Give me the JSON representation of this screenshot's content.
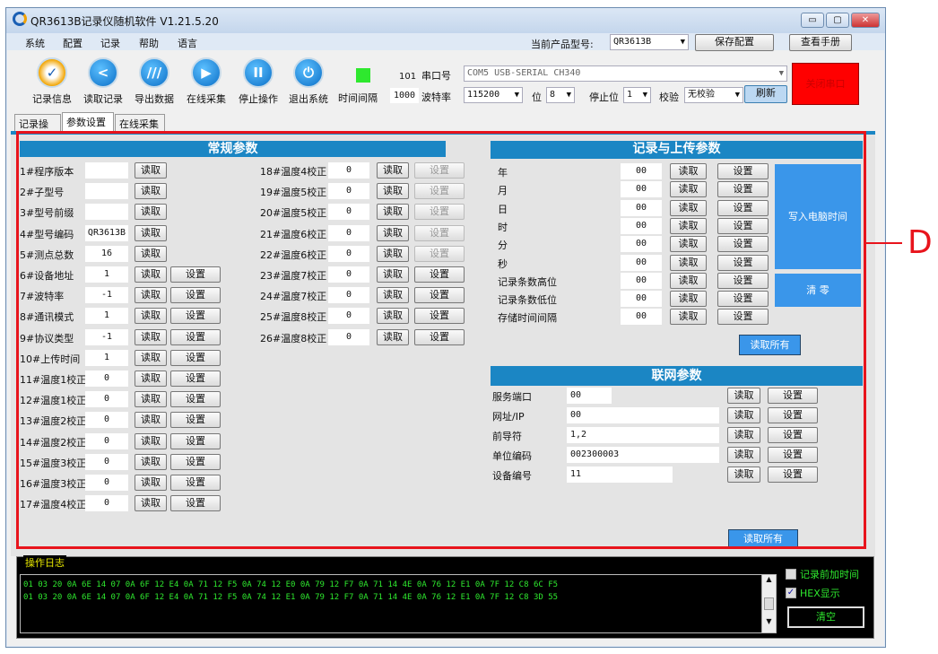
{
  "window": {
    "title": "QR3613B记录仪随机软件   V1.21.5.20"
  },
  "menu": [
    "系统",
    "配置",
    "记录",
    "帮助",
    "语言"
  ],
  "header": {
    "product_label": "当前产品型号:",
    "product_value": "QR3613B",
    "save_config": "保存配置",
    "view_manual": "查看手册"
  },
  "toolbar": {
    "buttons": [
      {
        "label": "记录信息",
        "icon": "record-info-icon",
        "glyph": "✓"
      },
      {
        "label": "读取记录",
        "icon": "share-icon",
        "glyph": "<"
      },
      {
        "label": "导出数据",
        "icon": "export-icon",
        "glyph": "///"
      },
      {
        "label": "在线采集",
        "icon": "play-icon",
        "glyph": "▶"
      },
      {
        "label": "停止操作",
        "icon": "pause-icon",
        "glyph": "II"
      },
      {
        "label": "退出系统",
        "icon": "power-icon",
        "glyph": "⏻"
      }
    ],
    "interval_label": "时间间隔",
    "interval_count": "101",
    "interval_value": "1000"
  },
  "serial": {
    "port_label": "串口号",
    "port_value": "COM5 USB-SERIAL CH340",
    "baud_label": "波特率",
    "baud_value": "115200",
    "bits_label": "位",
    "bits_value": "8",
    "stop_label": "停止位",
    "stop_value": "1",
    "parity_label": "校验",
    "parity_value": "无校验",
    "refresh": "刷新",
    "close_port": "关闭串口"
  },
  "tabs": [
    "记录操作",
    "参数设置",
    "在线采集"
  ],
  "read": "读取",
  "set": "设置",
  "general": {
    "title": "常规参数",
    "rows": [
      {
        "label": "1#程序版本",
        "value": "",
        "set": false
      },
      {
        "label": "2#子型号",
        "value": "",
        "set": false
      },
      {
        "label": "3#型号前缀",
        "value": "",
        "set": false
      },
      {
        "label": "4#型号编码",
        "value": "QR3613B",
        "set": false
      },
      {
        "label": "5#测点总数",
        "value": "16",
        "set": false
      },
      {
        "label": "6#设备地址",
        "value": "1",
        "set": true
      },
      {
        "label": "7#波特率",
        "value": "-1",
        "set": true
      },
      {
        "label": "8#通讯模式",
        "value": "1",
        "set": true
      },
      {
        "label": "9#协议类型",
        "value": "-1",
        "set": true
      },
      {
        "label": "10#上传时间",
        "value": "1",
        "set": true
      },
      {
        "label": "11#温度1校正",
        "value": "0",
        "set": true
      },
      {
        "label": "12#温度1校正",
        "value": "0",
        "set": true
      },
      {
        "label": "13#温度2校正",
        "value": "0",
        "set": true
      },
      {
        "label": "14#温度2校正",
        "value": "0",
        "set": true
      },
      {
        "label": "15#温度3校正",
        "value": "0",
        "set": true
      },
      {
        "label": "16#温度3校正",
        "value": "0",
        "set": true
      },
      {
        "label": "17#温度4校正",
        "value": "0",
        "set": true
      }
    ],
    "rows2": [
      {
        "label": "18#温度4校正",
        "value": "0",
        "set_enabled": false
      },
      {
        "label": "19#温度5校正",
        "value": "0",
        "set_enabled": false
      },
      {
        "label": "20#温度5校正",
        "value": "0",
        "set_enabled": false
      },
      {
        "label": "21#温度6校正",
        "value": "0",
        "set_enabled": false
      },
      {
        "label": "22#温度6校正",
        "value": "0",
        "set_enabled": false
      },
      {
        "label": "23#温度7校正",
        "value": "0",
        "set_enabled": true
      },
      {
        "label": "24#温度7校正",
        "value": "0",
        "set_enabled": true
      },
      {
        "label": "25#温度8校正",
        "value": "0",
        "set_enabled": true
      },
      {
        "label": "26#温度8校正",
        "value": "0",
        "set_enabled": true
      }
    ]
  },
  "record": {
    "title": "记录与上传参数",
    "rows": [
      {
        "label": "年",
        "value": "00"
      },
      {
        "label": "月",
        "value": "00"
      },
      {
        "label": "日",
        "value": "00"
      },
      {
        "label": "时",
        "value": "00"
      },
      {
        "label": "分",
        "value": "00"
      },
      {
        "label": "秒",
        "value": "00"
      },
      {
        "label": "记录条数高位",
        "value": "00"
      },
      {
        "label": "记录条数低位",
        "value": "00"
      },
      {
        "label": "存储时间间隔",
        "value": "00"
      }
    ],
    "write_pc_time": "写入电脑时间",
    "clear": "清 零",
    "read_all": "读取所有"
  },
  "network": {
    "title": "联网参数",
    "rows": [
      {
        "label": "服务端口",
        "value": "00"
      },
      {
        "label": "网址/IP",
        "value": "00"
      },
      {
        "label": "前导符",
        "value": "1,2"
      },
      {
        "label": "单位编码",
        "value": "002300003"
      },
      {
        "label": "设备编号",
        "value": "11"
      }
    ],
    "read_all": "读取所有"
  },
  "log": {
    "title": "操作日志",
    "lines": [
      "01 03 20 0A 6E 14 07 0A 6F 12 E4 0A 71 12 F5 0A 74 12 E0 0A 79 12 F7 0A 71 14 4E 0A 76 12 E1 0A 7F 12 C8 6C F5",
      "01 03 20 0A 6E 14 07 0A 6F 12 E4 0A 71 12 F5 0A 74 12 E1 0A 79 12 F7 0A 71 14 4E 0A 76 12 E1 0A 7F 12 C8 3D 55"
    ],
    "add_time_label": "记录前加时间",
    "add_time_checked": false,
    "hex_label": "HEX显示",
    "hex_checked": true,
    "clear": "清空"
  },
  "annotation": "D",
  "colors": {
    "accent": "#1b86c4",
    "highlight": "#e8141c",
    "close_port": "#ff0000",
    "log_text": "#2ee82e"
  }
}
